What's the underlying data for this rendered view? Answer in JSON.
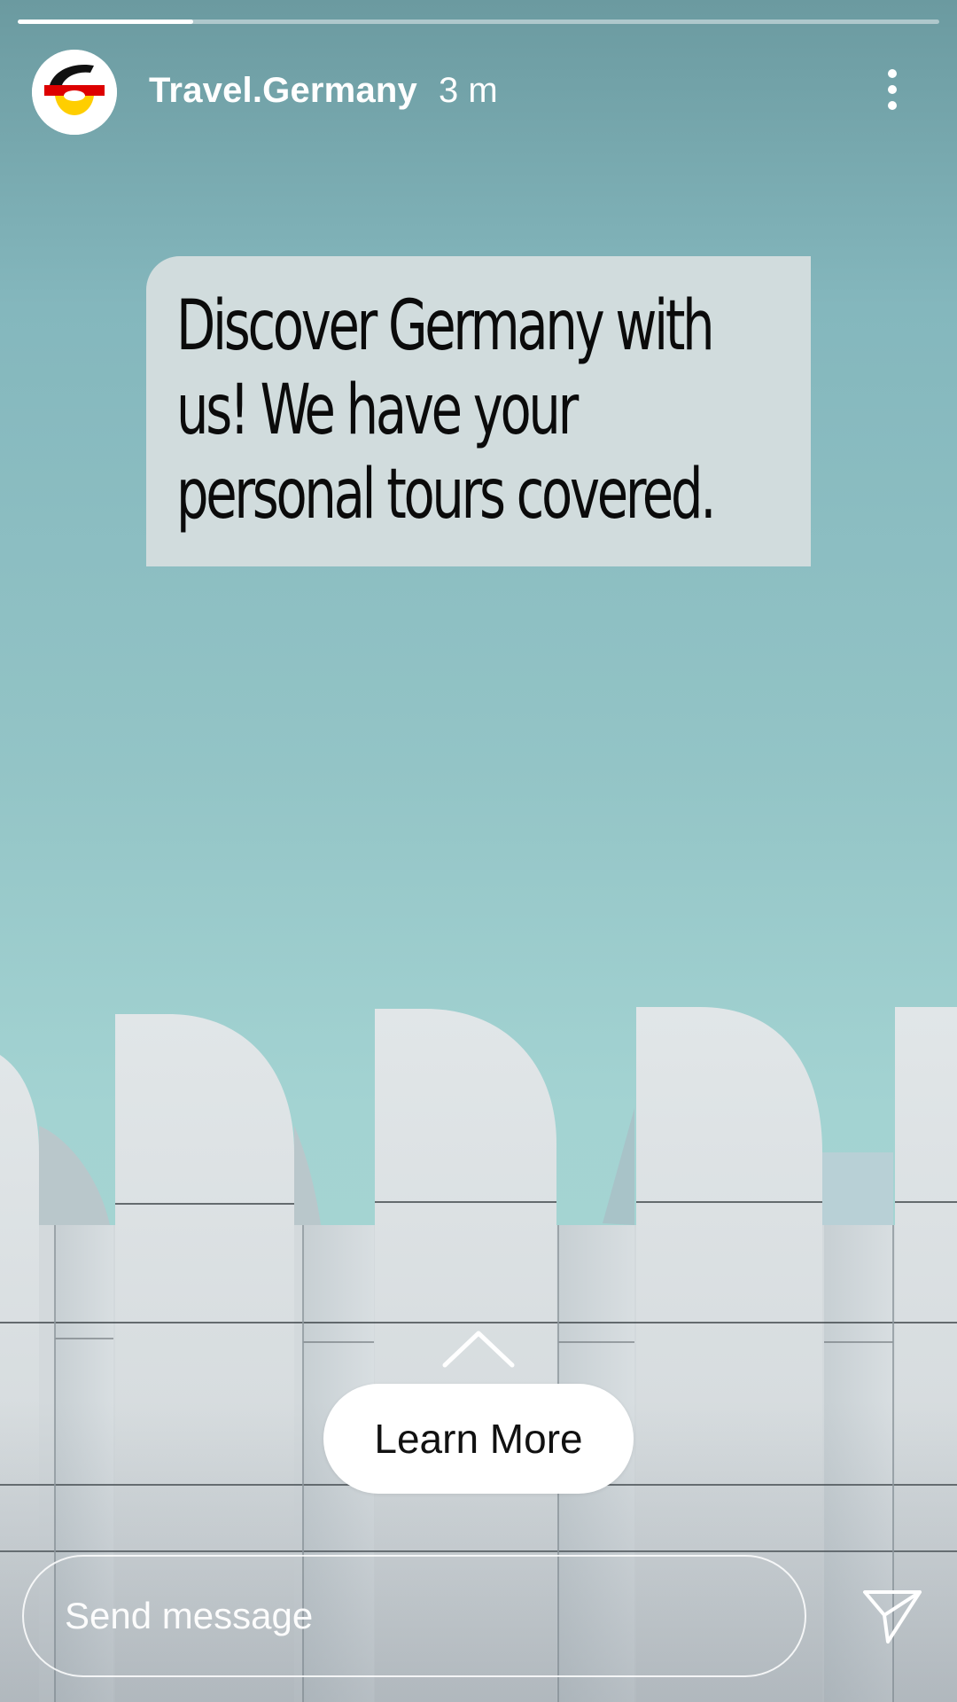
{
  "story": {
    "progress": 0.19,
    "account": {
      "username": "Travel.Germany",
      "time_ago": "3 m",
      "avatar_icon": "germany-flag-logo-icon"
    },
    "caption": "Discover Germany with us! We have your personal tours covered.",
    "cta": {
      "label": "Learn More",
      "swipe_icon": "chevron-up-icon"
    },
    "message": {
      "placeholder": "Send message",
      "send_icon": "send-icon"
    },
    "menu_icon": "more-vertical-icon"
  },
  "colors": {
    "sky_top": "#6b9aa0",
    "sky_bottom": "#a8d6d4",
    "card": "#d1dcdd",
    "flag_black": "#111111",
    "flag_red": "#dd0000",
    "flag_gold": "#ffce00"
  }
}
